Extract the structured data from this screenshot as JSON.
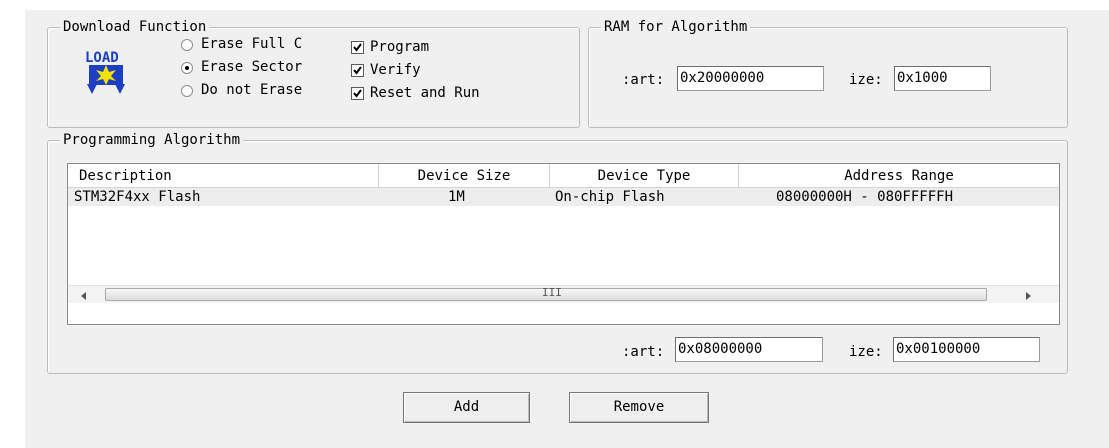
{
  "download": {
    "title": "Download Function",
    "radios": [
      {
        "label": "Erase Full C",
        "checked": false
      },
      {
        "label": "Erase Sector",
        "checked": true
      },
      {
        "label": "Do not Erase",
        "checked": false
      }
    ],
    "checks": [
      {
        "label": "Program",
        "checked": true
      },
      {
        "label": "Verify",
        "checked": true
      },
      {
        "label": "Reset and Run",
        "checked": true
      }
    ],
    "load_icon_text": "LOAD"
  },
  "ram": {
    "title": "RAM for Algorithm",
    "start_label": ":art:",
    "start_value": "0x20000000",
    "size_label": "ize:",
    "size_value": "0x1000"
  },
  "algo": {
    "title": "Programming Algorithm",
    "columns": [
      "Description",
      "Device Size",
      "Device Type",
      "Address Range"
    ],
    "rows": [
      {
        "description": "STM32F4xx Flash",
        "size": "1M",
        "type": "On-chip Flash",
        "range": "08000000H - 080FFFFFH"
      }
    ],
    "scroll_grip": "III",
    "start_label": ":art:",
    "start_value": "0x08000000",
    "size_label": "ize:",
    "size_value": "0x00100000"
  },
  "buttons": {
    "add": "Add",
    "remove": "Remove"
  },
  "colors": {
    "icon_blue": "#1d3fc4",
    "icon_yellow": "#f2e200"
  }
}
